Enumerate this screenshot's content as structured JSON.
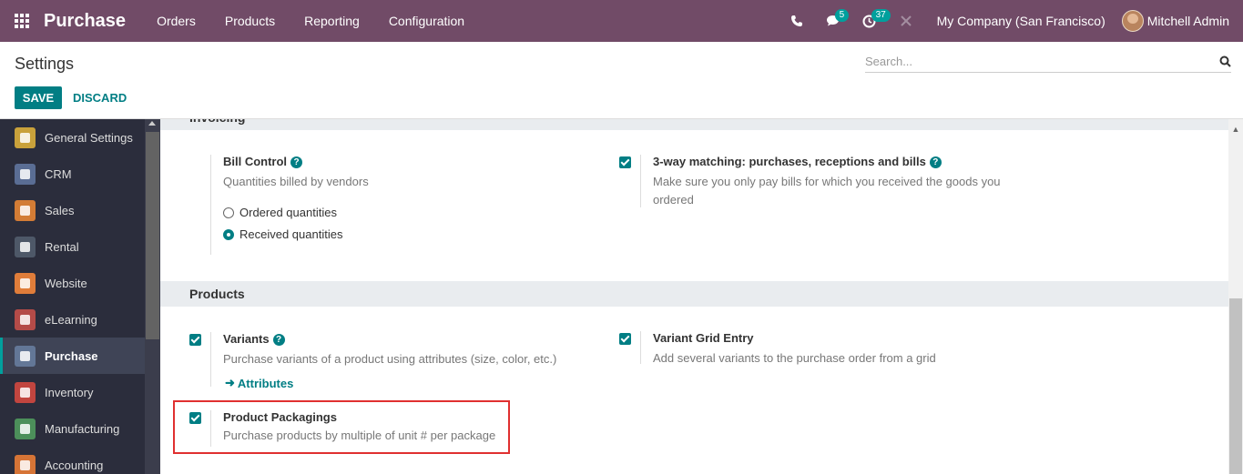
{
  "navbar": {
    "app_title": "Purchase",
    "menu": [
      "Orders",
      "Products",
      "Reporting",
      "Configuration"
    ],
    "messages_count": "5",
    "activities_count": "37",
    "company": "My Company (San Francisco)",
    "user": "Mitchell Admin"
  },
  "control_panel": {
    "title": "Settings",
    "search_placeholder": "Search...",
    "save_label": "SAVE",
    "discard_label": "DISCARD"
  },
  "sidebar": {
    "items": [
      {
        "label": "General Settings",
        "icon": "gear-icon",
        "color": "#c9a13b"
      },
      {
        "label": "CRM",
        "icon": "crm-icon",
        "color": "#5a6d94"
      },
      {
        "label": "Sales",
        "icon": "sales-icon",
        "color": "#d37c35"
      },
      {
        "label": "Rental",
        "icon": "rental-icon",
        "color": "#4e5868"
      },
      {
        "label": "Website",
        "icon": "website-icon",
        "color": "#e07d3a"
      },
      {
        "label": "eLearning",
        "icon": "elearning-icon",
        "color": "#b44b48"
      },
      {
        "label": "Purchase",
        "icon": "purchase-icon",
        "color": "#637797"
      },
      {
        "label": "Inventory",
        "icon": "inventory-icon",
        "color": "#c2453f"
      },
      {
        "label": "Manufacturing",
        "icon": "manufacturing-icon",
        "color": "#4c8f5a"
      },
      {
        "label": "Accounting",
        "icon": "accounting-icon",
        "color": "#d67436"
      }
    ],
    "active_index": 6
  },
  "content": {
    "invoicing_header": "Invoicing",
    "bill_control": {
      "label": "Bill Control",
      "description": "Quantities billed by vendors",
      "options": [
        "Ordered quantities",
        "Received quantities"
      ],
      "selected": "Received quantities"
    },
    "three_way": {
      "label": "3-way matching: purchases, receptions and bills",
      "description_1": "Make sure you only pay bills for which you received the goods you",
      "description_2": "ordered",
      "checked": true
    },
    "products_header": "Products",
    "variants": {
      "label": "Variants",
      "description": "Purchase variants of a product using attributes (size, color, etc.)",
      "link": "Attributes",
      "checked": true
    },
    "variant_grid": {
      "label": "Variant Grid Entry",
      "description": "Add several variants to the purchase order from a grid",
      "checked": true
    },
    "packagings": {
      "label": "Product Packagings",
      "description": "Purchase products by multiple of unit # per package",
      "checked": true
    }
  },
  "colors": {
    "navbar": "#714b67",
    "accent": "#017e84",
    "sidebar": "#2b2d3c",
    "highlight": "#e03030"
  }
}
